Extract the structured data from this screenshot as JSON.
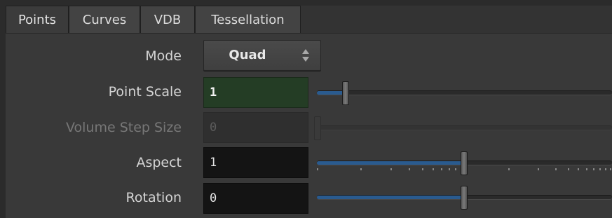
{
  "tabs": [
    {
      "label": "Points",
      "active": true
    },
    {
      "label": "Curves",
      "active": false
    },
    {
      "label": "VDB",
      "active": false
    },
    {
      "label": "Tessellation",
      "active": false
    }
  ],
  "params": {
    "mode": {
      "label": "Mode",
      "value": "Quad",
      "icon": "updown-arrows-icon"
    },
    "point_scale": {
      "label": "Point Scale",
      "value": "1",
      "slider_fraction": 0.1
    },
    "volume_step_size": {
      "label": "Volume Step Size",
      "value": "0",
      "disabled": true,
      "slider_fraction": 0.0
    },
    "aspect": {
      "label": "Aspect",
      "value": "1",
      "slider_fraction": 0.5
    },
    "rotation": {
      "label": "Rotation",
      "value": "0",
      "slider_fraction": 0.5
    }
  },
  "colors": {
    "accent_slider": "#2a5b8f",
    "edit_field": "#243d25"
  }
}
